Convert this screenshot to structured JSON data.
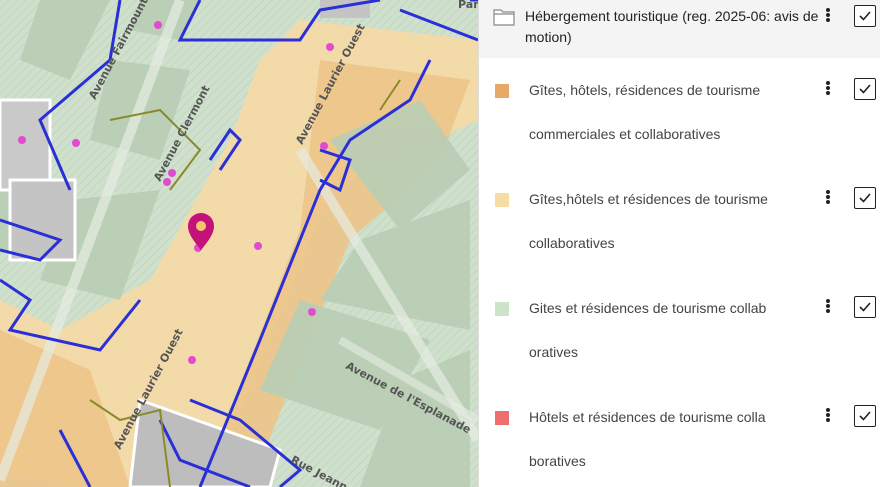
{
  "map": {
    "street_labels": [
      "Avenue Fairmount",
      "Avenue Clermont",
      "Avenue Laurier Ouest",
      "Avenue Laurier Ouest",
      "Avenue de l'Esplanade",
      "Rue Jeanne",
      "Par"
    ],
    "marker_icon": "map-pin-icon",
    "colors": {
      "base_green": "#cfe0cc",
      "block_green": "#b7cdb3",
      "commercial": "#efc48a",
      "collab": "#f6dcaa",
      "boundary_blue": "#2a2fd6",
      "boundary_olive": "#8a8a2a",
      "poi_pink": "#e24bd0",
      "marker_magenta": "#c4127a"
    }
  },
  "legend": {
    "group": {
      "icon": "folder-icon",
      "title": "Hébergement touristique (reg. 2025-06: avis de motion)",
      "checked": true
    },
    "layers": [
      {
        "label": "Gîtes, hôtels, résidences de tourisme commerciales et collaboratives",
        "color": "#e8a866",
        "checked": true
      },
      {
        "label": "Gîtes,hôtels et résidences de tourisme collaboratives",
        "color": "#f7dca4",
        "checked": true
      },
      {
        "label": "Gites et résidences de tourisme collab oratives",
        "color": "#cfe3cc",
        "checked": true
      },
      {
        "label": "Hôtels et résidences de tourisme colla boratives",
        "color": "#ee6e6e",
        "checked": true
      }
    ]
  }
}
